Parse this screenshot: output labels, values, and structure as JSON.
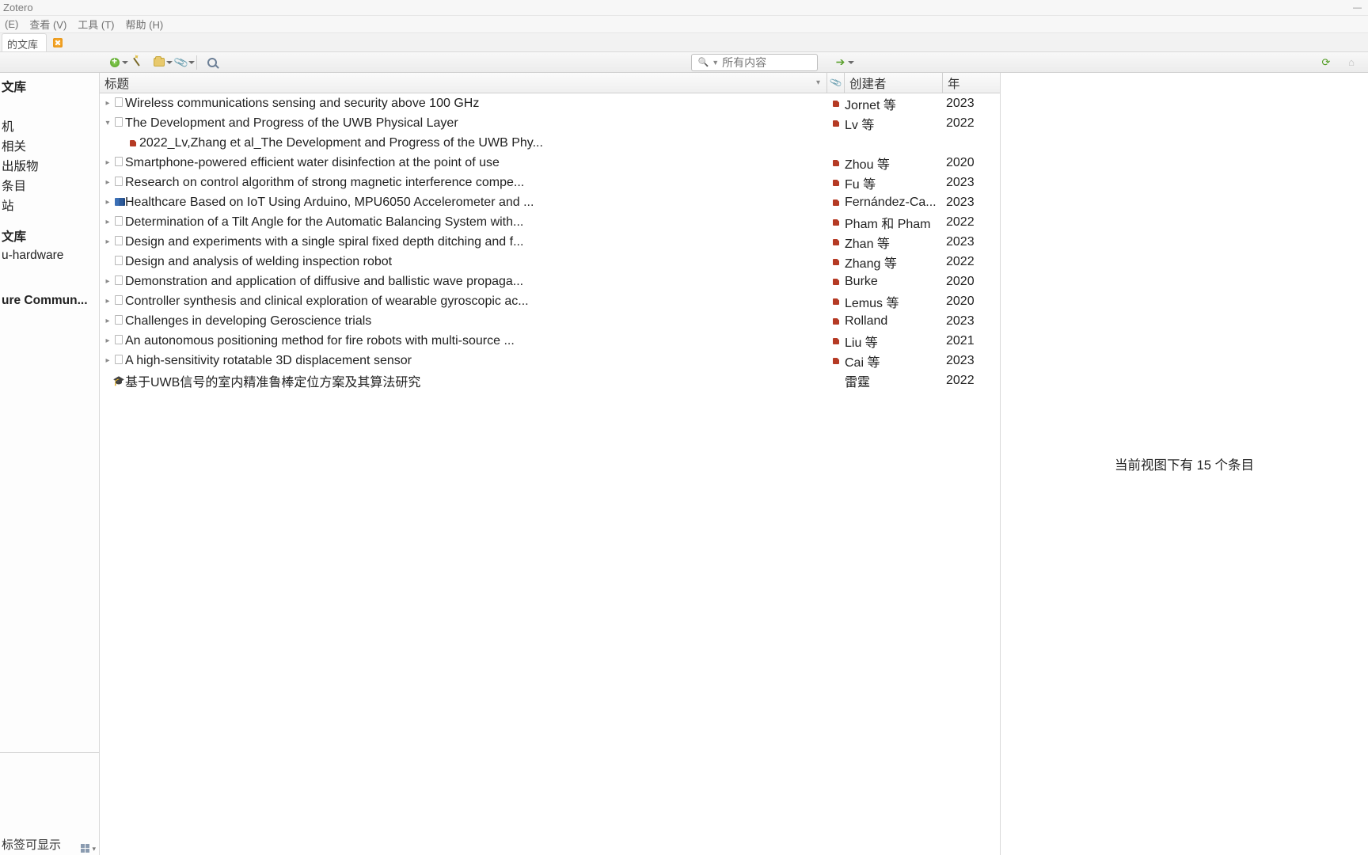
{
  "window": {
    "title": "Zotero"
  },
  "menus": [
    {
      "label": "(E)"
    },
    {
      "label": "查看 (V)"
    },
    {
      "label": "工具 (T)"
    },
    {
      "label": "帮助 (H)"
    }
  ],
  "tab": {
    "label": "的文库"
  },
  "search": {
    "scope": "所有内容"
  },
  "left_tree": {
    "top": [
      {
        "label": "文库",
        "bold": true
      },
      {
        "label": ""
      },
      {
        "label": "机"
      },
      {
        "label": "相关"
      },
      {
        "label": "出版物"
      },
      {
        "label": "条目"
      },
      {
        "label": "站"
      }
    ],
    "mid": [
      {
        "label": "文库",
        "bold": true
      },
      {
        "label": "u-hardware"
      }
    ],
    "bottom": [
      {
        "label": "ure Commun...",
        "bold": true
      }
    ]
  },
  "tag_area": {
    "message": "标签可显示"
  },
  "columns": {
    "title": "标题",
    "creator": "创建者",
    "year": "年"
  },
  "rows": [
    {
      "kind": "item",
      "twisty": "closed",
      "icon": "doc",
      "title": "Wireless communications sensing and security above 100 GHz",
      "has_pdf": true,
      "creator": "Jornet 等",
      "year": "2023"
    },
    {
      "kind": "item",
      "twisty": "open",
      "icon": "doc",
      "title": "The Development and Progress of the UWB Physical Layer",
      "has_pdf": true,
      "creator": "Lv 等",
      "year": "2022"
    },
    {
      "kind": "child",
      "icon": "pdf",
      "title": "2022_Lv,Zhang et al_The Development and Progress of the UWB Phy...",
      "has_pdf": false,
      "creator": "",
      "year": ""
    },
    {
      "kind": "item",
      "twisty": "closed",
      "icon": "doc",
      "title": "Smartphone-powered efficient water disinfection at the point of use",
      "has_pdf": true,
      "creator": "Zhou 等",
      "year": "2020"
    },
    {
      "kind": "item",
      "twisty": "closed",
      "icon": "doc",
      "title": "Research on control algorithm of strong magnetic interference compe...",
      "has_pdf": true,
      "creator": "Fu 等",
      "year": "2023"
    },
    {
      "kind": "item",
      "twisty": "closed",
      "icon": "book",
      "title": "Healthcare Based on IoT Using Arduino, MPU6050 Accelerometer and ...",
      "has_pdf": true,
      "creator": "Fernández-Ca...",
      "year": "2023"
    },
    {
      "kind": "item",
      "twisty": "closed",
      "icon": "doc",
      "title": "Determination of a Tilt Angle for the Automatic Balancing System with...",
      "has_pdf": true,
      "creator": "Pham 和 Pham",
      "year": "2022"
    },
    {
      "kind": "item",
      "twisty": "closed",
      "icon": "doc",
      "title": "Design and experiments with a single spiral fixed depth ditching and f...",
      "has_pdf": true,
      "creator": "Zhan 等",
      "year": "2023"
    },
    {
      "kind": "item",
      "twisty": "none",
      "icon": "doc",
      "title": "Design and analysis of welding inspection robot",
      "has_pdf": true,
      "creator": "Zhang 等",
      "year": "2022"
    },
    {
      "kind": "item",
      "twisty": "closed",
      "icon": "doc",
      "title": "Demonstration and application of diffusive and ballistic wave propaga...",
      "has_pdf": true,
      "creator": "Burke",
      "year": "2020"
    },
    {
      "kind": "item",
      "twisty": "closed",
      "icon": "doc",
      "title": "Controller synthesis and clinical exploration of wearable gyroscopic ac...",
      "has_pdf": true,
      "creator": "Lemus 等",
      "year": "2020"
    },
    {
      "kind": "item",
      "twisty": "closed",
      "icon": "doc",
      "title": "Challenges in developing Geroscience trials",
      "has_pdf": true,
      "creator": "Rolland",
      "year": "2023"
    },
    {
      "kind": "item",
      "twisty": "closed",
      "icon": "doc",
      "title": "An autonomous positioning method for fire robots with multi-source ...",
      "has_pdf": true,
      "creator": "Liu 等",
      "year": "2021"
    },
    {
      "kind": "item",
      "twisty": "closed",
      "icon": "doc",
      "title": "A high-sensitivity rotatable 3D displacement sensor",
      "has_pdf": true,
      "creator": "Cai 等",
      "year": "2023"
    },
    {
      "kind": "item",
      "twisty": "none",
      "icon": "cap",
      "title": "基于UWB信号的室内精准鲁棒定位方案及其算法研究",
      "has_pdf": false,
      "creator": "雷霆",
      "year": "2022"
    }
  ],
  "right_panel": {
    "status": "当前视图下有 15 个条目"
  }
}
